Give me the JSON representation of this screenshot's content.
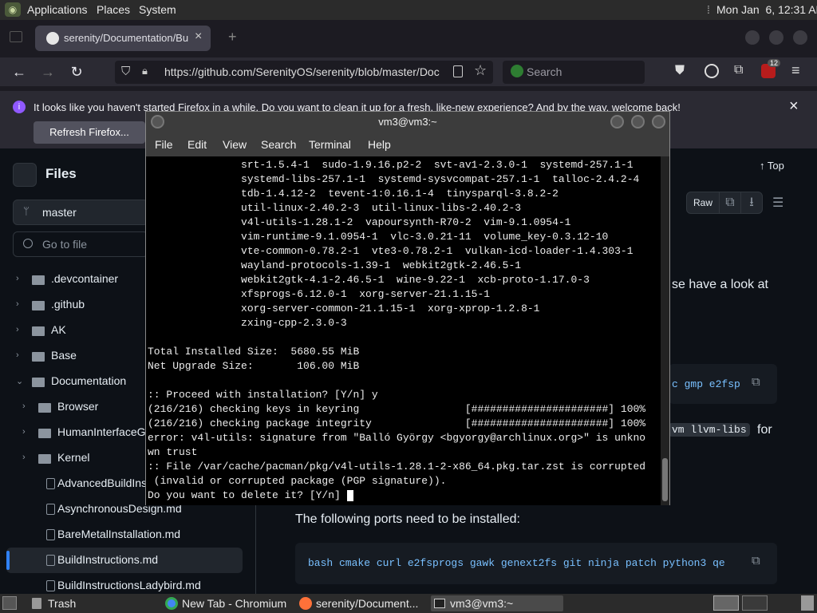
{
  "top_panel": {
    "menus": [
      "Applications",
      "Places",
      "System"
    ],
    "clock": "Mon Jan  6, 12:31 AM"
  },
  "browser": {
    "tab_title": "serenity/Documentation/Bu",
    "url": "https://github.com/SerenityOS/serenity/blob/master/Doc",
    "search_placeholder": "Search",
    "extension_badge": "12",
    "notification": "It looks like you haven't started Firefox in a while. Do you want to clean it up for a fresh, like-new experience? And by the way, welcome back!",
    "refresh_button": "Refresh Firefox..."
  },
  "github": {
    "sidebar_title": "Files",
    "branch": "master",
    "goto_placeholder": "Go to file",
    "tree": [
      {
        "name": ".devcontainer",
        "type": "folder",
        "depth": 0,
        "open": false
      },
      {
        "name": ".github",
        "type": "folder",
        "depth": 0,
        "open": false
      },
      {
        "name": "AK",
        "type": "folder",
        "depth": 0,
        "open": false
      },
      {
        "name": "Base",
        "type": "folder",
        "depth": 0,
        "open": false
      },
      {
        "name": "Documentation",
        "type": "folder",
        "depth": 0,
        "open": true
      },
      {
        "name": "Browser",
        "type": "folder",
        "depth": 1,
        "open": false
      },
      {
        "name": "HumanInterfaceG",
        "type": "folder",
        "depth": 1,
        "open": false
      },
      {
        "name": "Kernel",
        "type": "folder",
        "depth": 1,
        "open": false
      },
      {
        "name": "AdvancedBuildIns",
        "type": "file",
        "depth": 1
      },
      {
        "name": "AsynchronousDesign.md",
        "type": "file",
        "depth": 1
      },
      {
        "name": "BareMetalInstallation.md",
        "type": "file",
        "depth": 1
      },
      {
        "name": "BuildInstructions.md",
        "type": "file",
        "depth": 1,
        "selected": true
      },
      {
        "name": "BuildInstructionsLadybird.md",
        "type": "file",
        "depth": 1
      }
    ],
    "top_link": "Top",
    "raw_button": "Raw",
    "partial_text_1": "se have a look at",
    "code_frag_1": "c gmp e2fsp",
    "code_frag_2": "vm llvm-libs",
    "partial_text_2": "for",
    "ports_heading": "The following ports need to be installed:",
    "ports_code": "bash cmake curl e2fsprogs gawk genext2fs git ninja patch python3 qe"
  },
  "terminal": {
    "title": "vm3@vm3:~",
    "menus": [
      "File",
      "Edit",
      "View",
      "Search",
      "Terminal",
      "Help"
    ],
    "lines": [
      "               srt-1.5.4-1  sudo-1.9.16.p2-2  svt-av1-2.3.0-1  systemd-257.1-1",
      "               systemd-libs-257.1-1  systemd-sysvcompat-257.1-1  talloc-2.4.2-4",
      "               tdb-1.4.12-2  tevent-1:0.16.1-4  tinysparql-3.8.2-2",
      "               util-linux-2.40.2-3  util-linux-libs-2.40.2-3",
      "               v4l-utils-1.28.1-2  vapoursynth-R70-2  vim-9.1.0954-1",
      "               vim-runtime-9.1.0954-1  vlc-3.0.21-11  volume_key-0.3.12-10",
      "               vte-common-0.78.2-1  vte3-0.78.2-1  vulkan-icd-loader-1.4.303-1",
      "               wayland-protocols-1.39-1  webkit2gtk-2.46.5-1",
      "               webkit2gtk-4.1-2.46.5-1  wine-9.22-1  xcb-proto-1.17.0-3",
      "               xfsprogs-6.12.0-1  xorg-server-21.1.15-1",
      "               xorg-server-common-21.1.15-1  xorg-xprop-1.2.8-1",
      "               zxing-cpp-2.3.0-3",
      "",
      "Total Installed Size:  5680.55 MiB",
      "Net Upgrade Size:       106.00 MiB",
      "",
      ":: Proceed with installation? [Y/n] y",
      "(216/216) checking keys in keyring                 [######################] 100%",
      "(216/216) checking package integrity               [######################] 100%",
      "error: v4l-utils: signature from \"Balló György <bgyorgy@archlinux.org>\" is unkno",
      "wn trust",
      ":: File /var/cache/pacman/pkg/v4l-utils-1.28.1-2-x86_64.pkg.tar.zst is corrupted",
      " (invalid or corrupted package (PGP signature)).",
      "Do you want to delete it? [Y/n] "
    ]
  },
  "taskbar": {
    "items": [
      "Trash",
      "New Tab - Chromium",
      "serenity/Document...",
      "vm3@vm3:~"
    ]
  }
}
